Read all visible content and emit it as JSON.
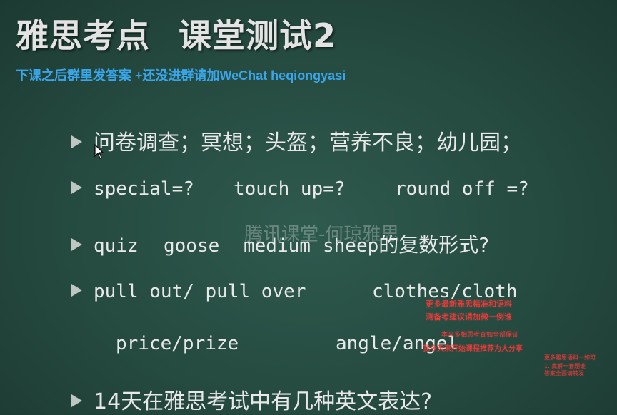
{
  "slide": {
    "title_part1": "雅思考点",
    "title_part2": "课堂测试2",
    "subtitle": "下课之后群里发答案 +还没进群请加WeChat heqiongyasi",
    "items": [
      {
        "text": "问卷调查；冥想；头盔；营养不良；幼儿园；"
      },
      {
        "segments": [
          "special=?",
          "touch up=?",
          "round off =?"
        ]
      },
      {
        "segments": [
          "quiz",
          "goose",
          "medium",
          "sheep"
        ],
        "suffix": "的复数形式?"
      },
      {
        "segments": [
          "pull out/ pull over",
          "clothes/cloth"
        ]
      },
      {
        "segments": [
          "price/prize",
          "angle/angel"
        ]
      },
      {
        "text": "14天在雅思考试中有几种英文表达?"
      }
    ]
  },
  "watermark": "腾讯课堂-何琼雅思",
  "promo_overlay": {
    "lines": [
      "更多最新雅思精准和语料",
      "测备考建议请加微一例谁",
      "本来多相思考查如全部保证",
      "我今天来开始课程推荐为大分享",
      "更多雅思语料一如可",
      "1. 真解一套题谁",
      "答案全面请转发"
    ]
  },
  "cursor": "arrow-cursor-icon"
}
